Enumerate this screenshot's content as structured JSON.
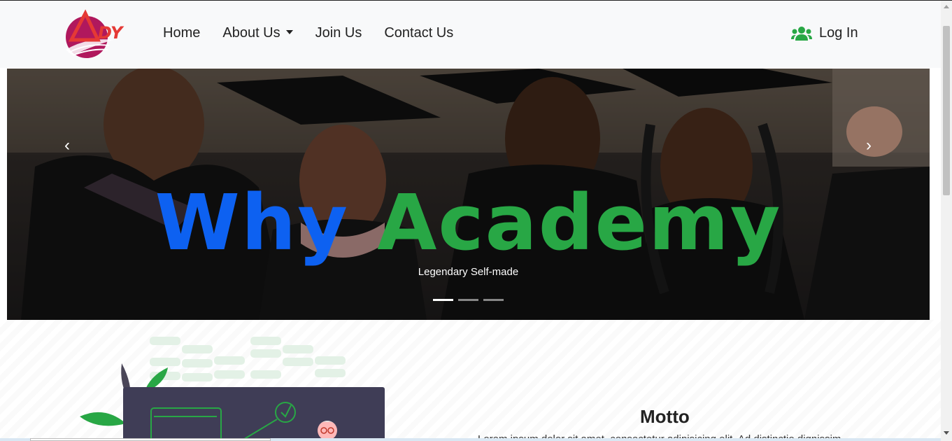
{
  "brand": {
    "logo_text": "ADY",
    "accent": "#c2185b",
    "accent2": "#e53935"
  },
  "nav": {
    "home": "Home",
    "about": "About Us",
    "join": "Join Us",
    "contact": "Contact Us",
    "login": "Log In",
    "login_icon": "users-icon"
  },
  "carousel": {
    "headline_word1": "Why",
    "headline_word2": "Academy",
    "caption": "Legendary Self-made",
    "prev_icon": "chevron-left-icon",
    "next_icon": "chevron-right-icon",
    "prev_glyph": "‹",
    "next_glyph": "›",
    "slide_count": 3,
    "active_slide": 1
  },
  "section": {
    "motto_title": "Motto",
    "motto_text": "Lorem ipsum dolor sit amet, consectetur adipisicing elit. Ad distinctio dignissimos"
  },
  "colors": {
    "headline_blue": "#0d61f1",
    "headline_green": "#28a745",
    "login_icon_green": "#28a745",
    "navbar_bg": "#f8f9fa"
  }
}
